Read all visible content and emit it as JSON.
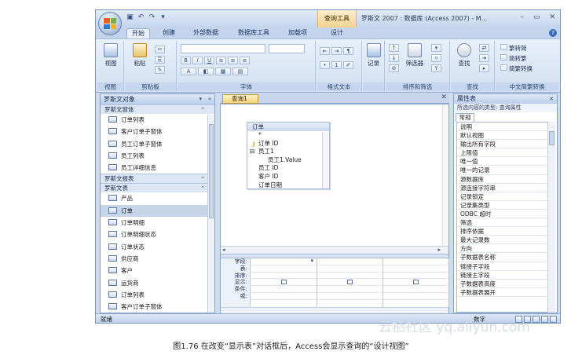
{
  "window": {
    "title": "罗斯文 2007 : 数据库 (Access 2007) - M...",
    "context_tool": "查询工具",
    "controls": [
      "–",
      "▭",
      "✕"
    ]
  },
  "ribbon_tabs": [
    "开始",
    "创建",
    "外部数据",
    "数据库工具",
    "加载项",
    "设计"
  ],
  "ribbon_groups": {
    "views": {
      "label": "视图",
      "button": "视图"
    },
    "clipboard": {
      "label": "剪贴板",
      "button": "粘贴"
    },
    "font": {
      "label": "字体"
    },
    "rich_text": {
      "label": "格式文本"
    },
    "records": {
      "button": "记录"
    },
    "sort_filter": {
      "label": "排序和筛选",
      "button": "筛选器"
    },
    "find": {
      "label": "查找",
      "button": "查找"
    },
    "chinese": {
      "label": "中文简繁转换",
      "items": [
        "繁转简",
        "简转繁",
        "简繁转换"
      ]
    }
  },
  "nav": {
    "header": "罗斯文对象",
    "groups": [
      {
        "title": "罗斯文窗体",
        "items": [
          "订单列表",
          "客户订单子窗体",
          "员工订单子窗体",
          "员工列表",
          "员工详细信息"
        ]
      },
      {
        "title": "罗斯文报表",
        "items": []
      },
      {
        "title": "罗斯文表",
        "items": [
          "产品",
          "订单",
          "订单明细",
          "订单明细状态",
          "订单状态",
          "供应商",
          "客户",
          "运货商",
          "订单列表",
          "客户订单子窗体"
        ]
      }
    ]
  },
  "query": {
    "tab_label": "查询1",
    "table": {
      "title": "订单",
      "fields": [
        "*",
        "订单 ID",
        "员工1",
        "员工1.Value",
        "员工 ID",
        "客户 ID",
        "订单日期"
      ]
    },
    "grid_rows": [
      "字段:",
      "表:",
      "排序:",
      "显示:",
      "条件:",
      "或:"
    ]
  },
  "props": {
    "header": "属性表",
    "subtitle": "所选内容的类型: 查询属性",
    "tab": "常规",
    "rows": [
      "说明",
      "默认视图",
      "输出所有字段",
      "上限值",
      "唯一值",
      "唯一的记录",
      "源数据库",
      "源连接字符串",
      "记录锁定",
      "记录集类型",
      "ODBC 超时",
      "筛选",
      "排序依据",
      "最大记录数",
      "方向",
      "子数据表名称",
      "链接子字段",
      "链接主字段",
      "子数据表高度",
      "子数据表展开"
    ]
  },
  "status": {
    "left": "就绪",
    "right": "数字"
  },
  "watermark": "云栖社区 yq.aliyun.com",
  "caption": "图1.76   在改变“显示表”对话框后，Access会显示查询的“设计视图”"
}
